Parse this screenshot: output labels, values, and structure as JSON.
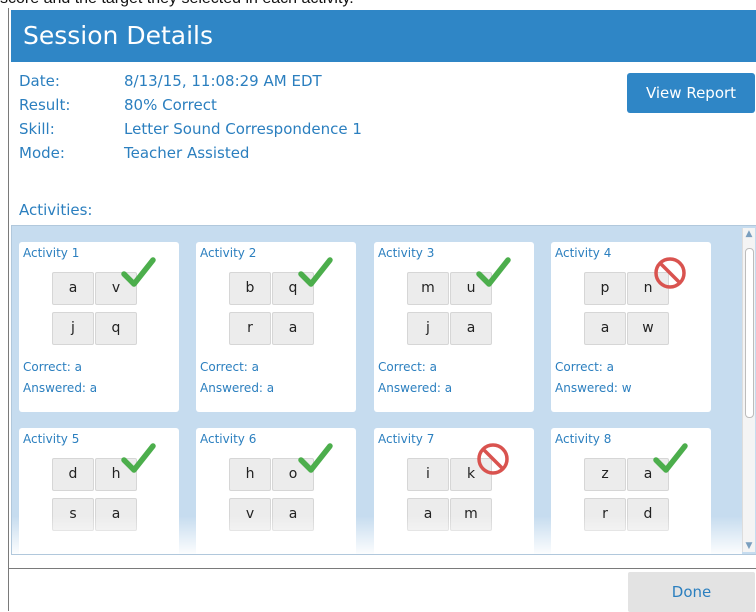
{
  "caption": "score and the target they selected in each activity.",
  "dialog": {
    "title": "Session Details",
    "fields": [
      {
        "label": "Date:",
        "value": "8/13/15, 11:08:29 AM EDT"
      },
      {
        "label": "Result:",
        "value": "80% Correct"
      },
      {
        "label": "Skill:",
        "value": "Letter Sound Correspondence 1"
      },
      {
        "label": "Mode:",
        "value": "Teacher Assisted"
      }
    ],
    "view_report_label": "View Report",
    "activities_label": "Activities:",
    "done_label": "Done",
    "colors": {
      "accent": "#2f86c6",
      "check": "#4cae4c",
      "wrong": "#d9534f",
      "panel": "#c6dcef"
    }
  },
  "activities": [
    {
      "title": "Activity 1",
      "letters": [
        "a",
        "v",
        "j",
        "q"
      ],
      "correct": "Correct: a",
      "answered": "Answered: a",
      "result": "check"
    },
    {
      "title": "Activity 2",
      "letters": [
        "b",
        "q",
        "r",
        "a"
      ],
      "correct": "Correct: a",
      "answered": "Answered: a",
      "result": "check"
    },
    {
      "title": "Activity 3",
      "letters": [
        "m",
        "u",
        "j",
        "a"
      ],
      "correct": "Correct: a",
      "answered": "Answered: a",
      "result": "check"
    },
    {
      "title": "Activity 4",
      "letters": [
        "p",
        "n",
        "a",
        "w"
      ],
      "correct": "Correct: a",
      "answered": "Answered: w",
      "result": "wrong"
    },
    {
      "title": "Activity 5",
      "letters": [
        "d",
        "h",
        "s",
        "a"
      ],
      "correct": "",
      "answered": "",
      "result": "check"
    },
    {
      "title": "Activity 6",
      "letters": [
        "h",
        "o",
        "v",
        "a"
      ],
      "correct": "",
      "answered": "",
      "result": "check"
    },
    {
      "title": "Activity 7",
      "letters": [
        "i",
        "k",
        "a",
        "m"
      ],
      "correct": "",
      "answered": "",
      "result": "wrong"
    },
    {
      "title": "Activity 8",
      "letters": [
        "z",
        "a",
        "r",
        "d"
      ],
      "correct": "",
      "answered": "",
      "result": "check"
    }
  ]
}
